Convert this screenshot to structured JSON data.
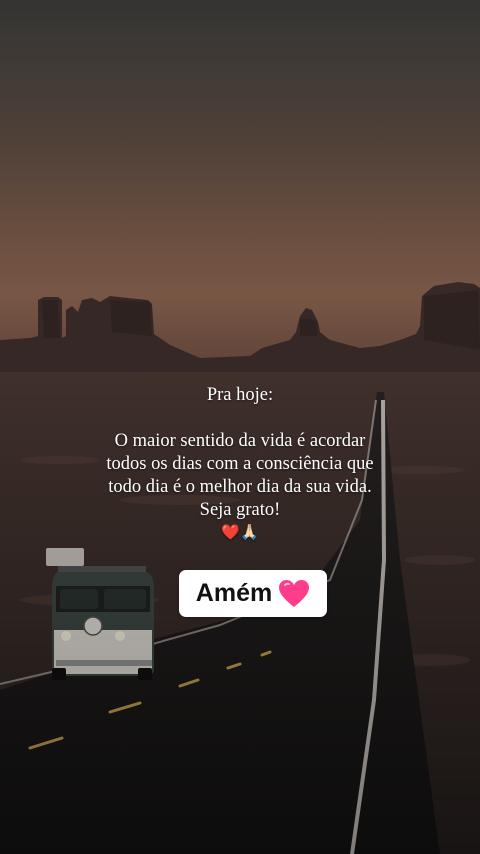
{
  "caption": {
    "heading": "Pra hoje:",
    "body_lines": [
      "O maior sentido da vida é acordar",
      "todos os dias com a consciência que",
      "todo dia é o melhor dia da sua vida.",
      "Seja grato!"
    ],
    "emojis": "❤️🙏🏻"
  },
  "sticker": {
    "label": "Amém",
    "icon": "pink-heart-icon",
    "heart_color": "#ff3d8b"
  }
}
